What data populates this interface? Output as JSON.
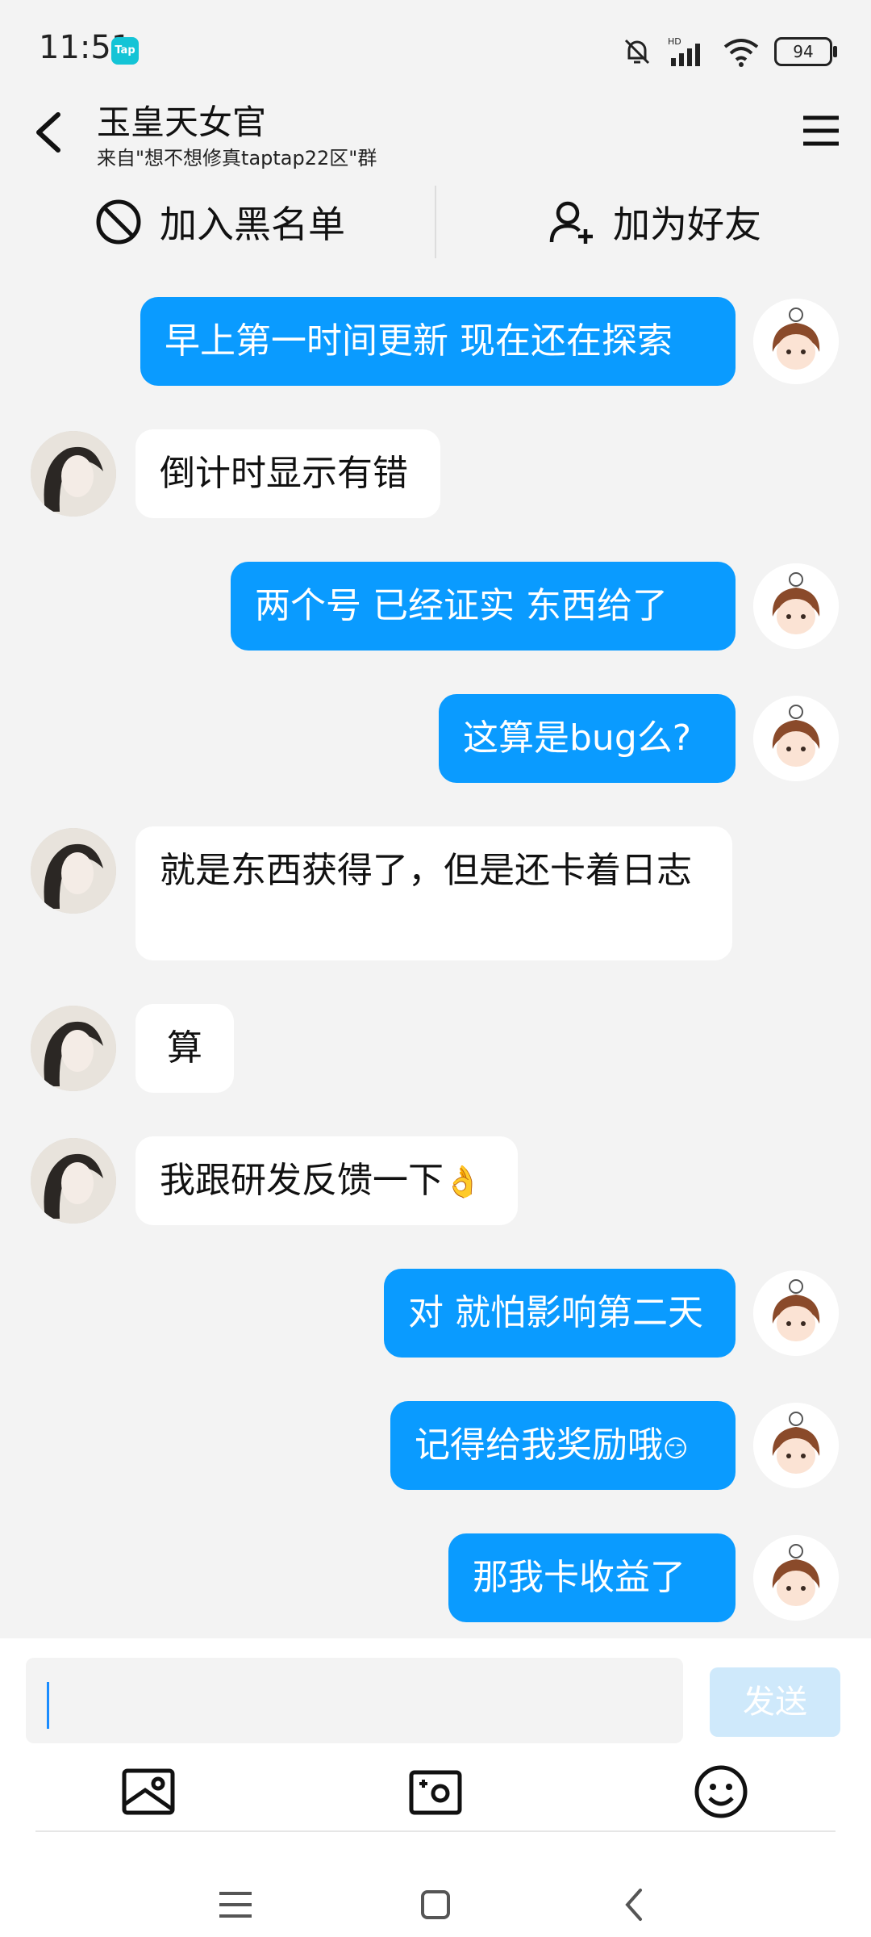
{
  "status": {
    "time": "11:51",
    "app_badge": "Tap",
    "battery": "94"
  },
  "header": {
    "title": "玉皇天女官",
    "subtitle": "来自\"想不想修真taptap22区\"群"
  },
  "actions": {
    "blacklist": "加入黑名单",
    "add_friend": "加为好友"
  },
  "messages": [
    {
      "side": "out",
      "text": "早上第一时间更新  现在还在探索"
    },
    {
      "side": "in",
      "text": "倒计时显示有错"
    },
    {
      "side": "out",
      "text": "两个号 已经证实  东西给了"
    },
    {
      "side": "out",
      "text": "这算是bug么?"
    },
    {
      "side": "in",
      "text": "就是东西获得了，但是还卡着日志"
    },
    {
      "side": "in",
      "text": "算"
    },
    {
      "side": "in",
      "text": "我跟研发反馈一下",
      "emoji": "👌"
    },
    {
      "side": "out",
      "text": "对 就怕影响第二天"
    },
    {
      "side": "out",
      "text": "记得给我奖励哦",
      "emoji": "😏"
    },
    {
      "side": "out",
      "text": "那我卡收益了"
    }
  ],
  "input": {
    "placeholder": "",
    "send": "发送"
  },
  "colors": {
    "accent": "#0a9bff",
    "send_disabled": "#cfe9fb"
  }
}
